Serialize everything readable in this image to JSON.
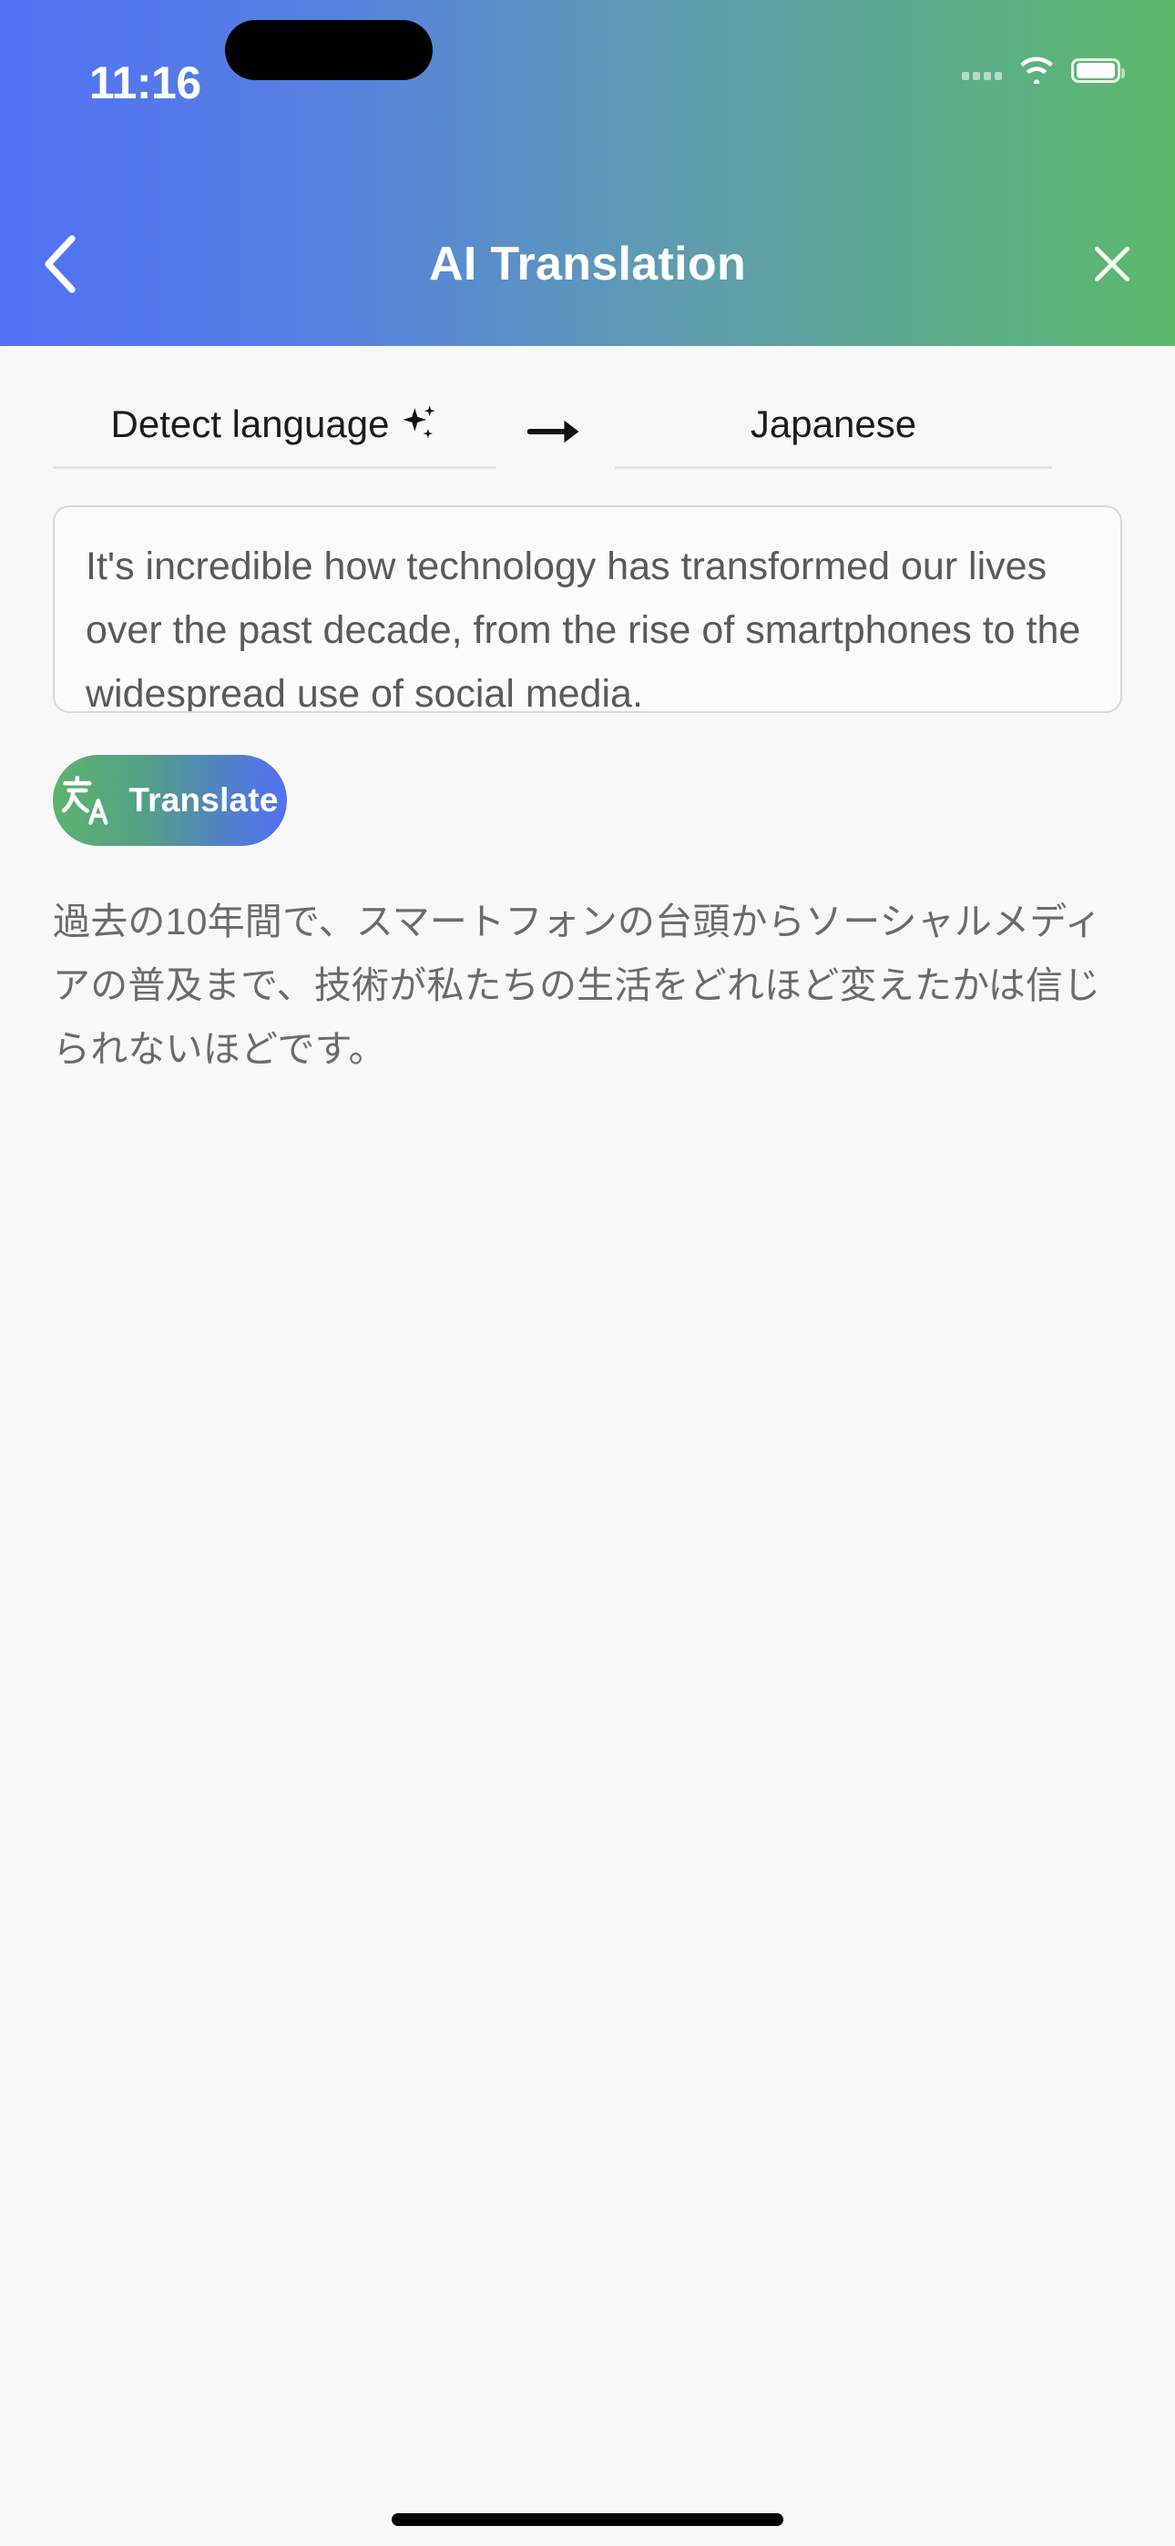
{
  "status_bar": {
    "time": "11:16",
    "signal_icon": "signal-dots-icon",
    "wifi_icon": "wifi-icon",
    "battery_icon": "battery-icon"
  },
  "header": {
    "title": "AI Translation",
    "back_icon": "chevron-left-icon",
    "close_icon": "close-x-icon",
    "gradient_start": "#5271f5",
    "gradient_end": "#5cb96a"
  },
  "language_selector": {
    "source_language": "Detect language",
    "source_sparkle_icon": "sparkles-icon",
    "arrow_icon": "arrow-right-icon",
    "target_language": "Japanese"
  },
  "source_input": {
    "value": "It's incredible how technology has transformed our lives over the past decade, from the rise of smartphones to the widespread use of social media.",
    "placeholder": "Enter text to translate"
  },
  "translate_button": {
    "label": "Translate",
    "icon": "translate-glyph-icon",
    "gradient_start": "#5cb36e",
    "gradient_end": "#5271f5"
  },
  "result": {
    "text": "過去の10年間で、スマートフォンの台頭からソーシャルメディアの普及まで、技術が私たちの生活をどれほど変えたかは信じられないほどです。"
  },
  "system": {
    "home_indicator": "home-indicator"
  }
}
